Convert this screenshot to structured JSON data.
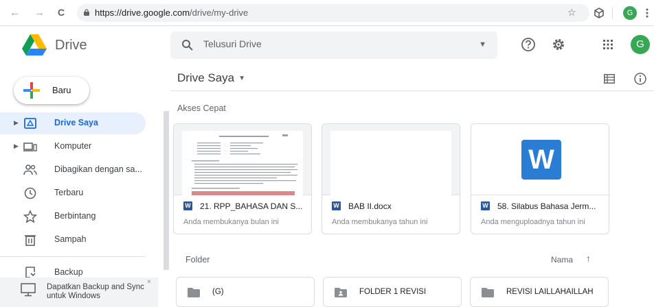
{
  "browser": {
    "back_glyph": "←",
    "forward_glyph": "→",
    "reload_glyph": "C",
    "url_host": "https://drive.google.com",
    "url_path": "/drive/my-drive",
    "star_glyph": "☆",
    "avatar_letter": "G"
  },
  "header": {
    "app_name": "Drive",
    "search_placeholder": "Telusuri Drive",
    "avatar_letter": "G"
  },
  "sidebar": {
    "new_label": "Baru",
    "items": [
      {
        "label": "Drive Saya",
        "icon": "my-drive-icon",
        "active": true,
        "expandable": true
      },
      {
        "label": "Komputer",
        "icon": "computer-icon",
        "active": false,
        "expandable": true
      },
      {
        "label": "Dibagikan dengan sa...",
        "icon": "shared-icon",
        "active": false,
        "expandable": false
      },
      {
        "label": "Terbaru",
        "icon": "clock-icon",
        "active": false,
        "expandable": false
      },
      {
        "label": "Berbintang",
        "icon": "star-icon",
        "active": false,
        "expandable": false
      },
      {
        "label": "Sampah",
        "icon": "trash-icon",
        "active": false,
        "expandable": false
      },
      {
        "label": "Backup",
        "icon": "backup-icon",
        "active": false,
        "expandable": false
      }
    ],
    "promo": {
      "text": "Dapatkan Backup and Sync untuk Windows",
      "close": "×"
    }
  },
  "main": {
    "title": "Drive Saya",
    "quick_access_label": "Akses Cepat",
    "quick_access": [
      {
        "name": "21. RPP_BAHASA DAN S...",
        "subtitle": "Anda membukanya bulan ini",
        "thumb": "document"
      },
      {
        "name": "BAB II.docx",
        "subtitle": "Anda membukanya tahun ini",
        "thumb": "blank"
      },
      {
        "name": "58. Silabus Bahasa Jerm...",
        "subtitle": "Anda menguploadnya tahun ini",
        "thumb": "word-logo"
      }
    ],
    "word_badge": "W",
    "folder_label": "Folder",
    "sort_label": "Nama",
    "sort_arrow": "↑",
    "folders": [
      {
        "name": "(G)",
        "icon": "folder-icon"
      },
      {
        "name": "FOLDER 1 REVISI",
        "icon": "shared-folder-icon"
      },
      {
        "name": "REVISI LAILLAHAILLAH",
        "icon": "folder-icon"
      }
    ]
  },
  "colors": {
    "accent_blue": "#1a73e8",
    "active_bg": "#e8f0fe",
    "word_blue": "#2a5699",
    "avatar_green": "#34a853"
  }
}
